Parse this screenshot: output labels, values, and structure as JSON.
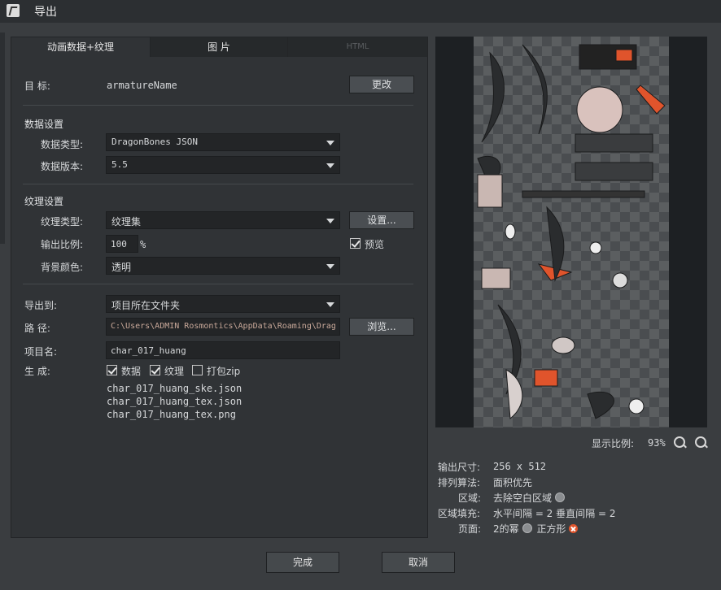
{
  "window": {
    "title": "导出"
  },
  "tabs": [
    {
      "label": "动画数据+纹理"
    },
    {
      "label": "图 片"
    },
    {
      "label": "HTML"
    }
  ],
  "target": {
    "label": "目  标:",
    "value": "armatureName",
    "change_button": "更改"
  },
  "data_settings": {
    "section_title": "数据设置",
    "type_label": "数据类型:",
    "type_value": "DragonBones JSON",
    "version_label": "数据版本:",
    "version_value": "5.5"
  },
  "texture_settings": {
    "section_title": "纹理设置",
    "type_label": "纹理类型:",
    "type_value": "纹理集",
    "settings_button": "设置...",
    "scale_label": "输出比例:",
    "scale_value": "100",
    "scale_unit": "%",
    "preview_label": "预览",
    "preview_checked": true,
    "bg_label": "背景颜色:",
    "bg_value": "透明"
  },
  "export": {
    "to_label": "导出到:",
    "to_value": "项目所在文件夹",
    "path_label": "路  径:",
    "path_value": "C:\\Users\\ADMIN Rosmontics\\AppData\\Roaming\\Drag",
    "browse_button": "浏览...",
    "project_label": "项目名:",
    "project_value": "char_017_huang",
    "generate_label": "生  成:",
    "options": [
      {
        "label": "数据",
        "checked": true
      },
      {
        "label": "纹理",
        "checked": true
      },
      {
        "label": "打包zip",
        "checked": false
      }
    ],
    "files": [
      "char_017_huang_ske.json",
      "char_017_huang_tex.json",
      "char_017_huang_tex.png"
    ]
  },
  "preview_panel": {
    "zoom_label": "显示比例:",
    "zoom_value": "93%",
    "info": {
      "size_label": "输出尺寸:",
      "size_value": "256 x 512",
      "algo_label": "排列算法:",
      "algo_value": "面积优先",
      "region_label": "区域:",
      "region_value": "去除空白区域",
      "padding_label": "区域填充:",
      "padding_value": "水平间隔 = 2  垂直间隔 = 2",
      "page_label": "页面:",
      "page_value": "2的幂",
      "page_value2": "正方形"
    }
  },
  "footer": {
    "ok_button": "完成",
    "cancel_button": "取消"
  },
  "colors": {
    "accent_orange": "#e0542c",
    "panel": "#303336",
    "field": "#232527"
  }
}
